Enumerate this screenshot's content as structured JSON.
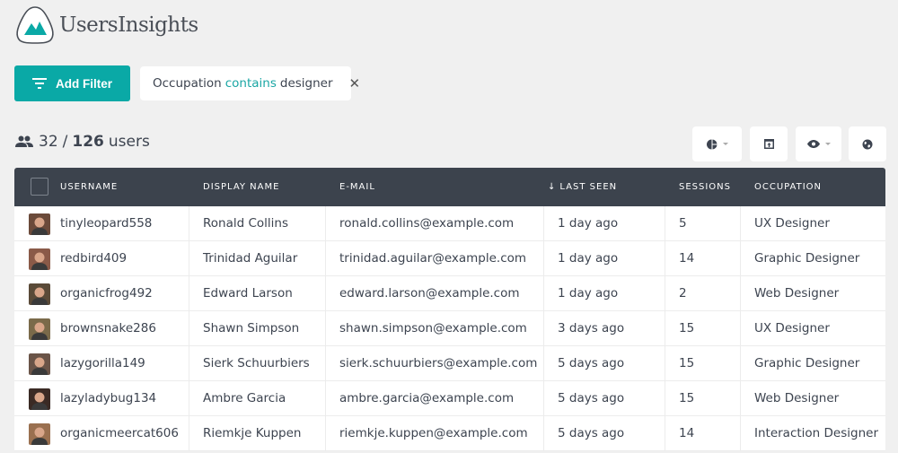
{
  "app": {
    "title": "UsersInsights",
    "brand_color": "#0aa9a6",
    "header_bg": "#3c434d"
  },
  "toolbar": {
    "add_filter_label": "Add Filter",
    "filter": {
      "field": "Occupation",
      "operator": "contains",
      "value": "designer",
      "remove_icon": "close-icon"
    }
  },
  "summary": {
    "filtered_count": "32",
    "separator": "/",
    "total_count": "126",
    "unit": "users"
  },
  "actions": [
    {
      "name": "segments-button",
      "icon": "pie-chart-icon",
      "has_dropdown": true
    },
    {
      "name": "export-button",
      "icon": "export-icon",
      "has_dropdown": false
    },
    {
      "name": "columns-visibility-button",
      "icon": "eye-icon",
      "has_dropdown": true
    },
    {
      "name": "map-view-button",
      "icon": "globe-icon",
      "has_dropdown": false
    }
  ],
  "table": {
    "columns": [
      {
        "key": "username",
        "label": "USERNAME"
      },
      {
        "key": "display_name",
        "label": "DISPLAY NAME"
      },
      {
        "key": "email",
        "label": "E-MAIL"
      },
      {
        "key": "last_seen",
        "label": "LAST SEEN",
        "sort": "desc",
        "sort_icon": "↓"
      },
      {
        "key": "sessions",
        "label": "SESSIONS"
      },
      {
        "key": "occupation",
        "label": "OCCUPATION"
      }
    ],
    "rows": [
      {
        "username": "tinyleopard558",
        "display_name": "Ronald Collins",
        "email": "ronald.collins@example.com",
        "last_seen": "1 day ago",
        "sessions": "5",
        "occupation": "UX Designer",
        "avatar_color": "#6b4a3a"
      },
      {
        "username": "redbird409",
        "display_name": "Trinidad Aguilar",
        "email": "trinidad.aguilar@example.com",
        "last_seen": "1 day ago",
        "sessions": "14",
        "occupation": "Graphic Designer",
        "avatar_color": "#8a5a48"
      },
      {
        "username": "organicfrog492",
        "display_name": "Edward Larson",
        "email": "edward.larson@example.com",
        "last_seen": "1 day ago",
        "sessions": "2",
        "occupation": "Web Designer",
        "avatar_color": "#5a4a38"
      },
      {
        "username": "brownsnake286",
        "display_name": "Shawn Simpson",
        "email": "shawn.simpson@example.com",
        "last_seen": "3 days ago",
        "sessions": "15",
        "occupation": "UX Designer",
        "avatar_color": "#7a6a4a"
      },
      {
        "username": "lazygorilla149",
        "display_name": "Sierk Schuurbiers",
        "email": "sierk.schuurbiers@example.com",
        "last_seen": "5 days ago",
        "sessions": "15",
        "occupation": "Graphic Designer",
        "avatar_color": "#6a5448"
      },
      {
        "username": "lazyladybug134",
        "display_name": "Ambre Garcia",
        "email": "ambre.garcia@example.com",
        "last_seen": "5 days ago",
        "sessions": "15",
        "occupation": "Web Designer",
        "avatar_color": "#3a2a24"
      },
      {
        "username": "organicmeercat606",
        "display_name": "Riemkje Kuppen",
        "email": "riemkje.kuppen@example.com",
        "last_seen": "5 days ago",
        "sessions": "14",
        "occupation": "Interaction Designer",
        "avatar_color": "#9a7050"
      }
    ]
  }
}
